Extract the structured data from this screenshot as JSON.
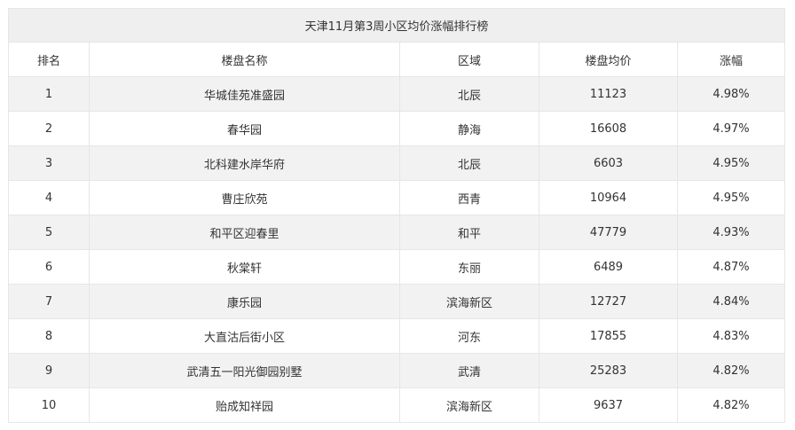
{
  "table": {
    "title": "天津11月第3周小区均价涨幅排行榜",
    "headers": [
      "排名",
      "楼盘名称",
      "区域",
      "楼盘均价",
      "涨幅"
    ],
    "rows": [
      {
        "rank": "1",
        "name": "华城佳苑准盛园",
        "district": "北辰",
        "price": "11123",
        "change": "4.98%"
      },
      {
        "rank": "2",
        "name": "春华园",
        "district": "静海",
        "price": "16608",
        "change": "4.97%"
      },
      {
        "rank": "3",
        "name": "北科建水岸华府",
        "district": "北辰",
        "price": "6603",
        "change": "4.95%"
      },
      {
        "rank": "4",
        "name": "曹庄欣苑",
        "district": "西青",
        "price": "10964",
        "change": "4.95%"
      },
      {
        "rank": "5",
        "name": "和平区迎春里",
        "district": "和平",
        "price": "47779",
        "change": "4.93%"
      },
      {
        "rank": "6",
        "name": "秋棠轩",
        "district": "东丽",
        "price": "6489",
        "change": "4.87%"
      },
      {
        "rank": "7",
        "name": "康乐园",
        "district": "滨海新区",
        "price": "12727",
        "change": "4.84%"
      },
      {
        "rank": "8",
        "name": "大直沽后街小区",
        "district": "河东",
        "price": "17855",
        "change": "4.83%"
      },
      {
        "rank": "9",
        "name": "武清五一阳光御园别墅",
        "district": "武清",
        "price": "25283",
        "change": "4.82%"
      },
      {
        "rank": "10",
        "name": "贻成知祥园",
        "district": "滨海新区",
        "price": "9637",
        "change": "4.82%"
      }
    ]
  }
}
